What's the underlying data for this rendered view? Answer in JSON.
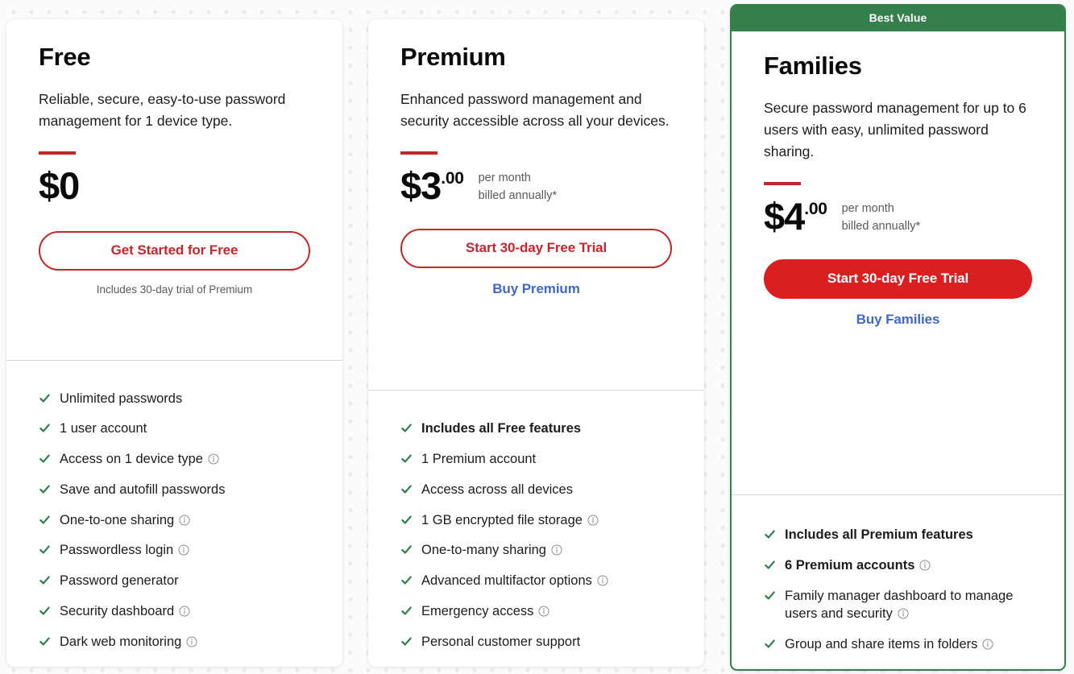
{
  "plans": [
    {
      "name": "Free",
      "description": "Reliable, secure, easy-to-use password management for 1 device type.",
      "price_main": "$0",
      "price_cents": "",
      "price_note_line1": "",
      "price_note_line2": "",
      "primary_cta": "Get Started for Free",
      "secondary_cta": "",
      "trial_note": "Includes 30-day trial of Premium",
      "badge": "",
      "features": [
        {
          "text": "Unlimited passwords",
          "bold": false,
          "info": false
        },
        {
          "text": "1 user account",
          "bold": false,
          "info": false
        },
        {
          "text": "Access on 1 device type",
          "bold": false,
          "info": true
        },
        {
          "text": "Save and autofill passwords",
          "bold": false,
          "info": false
        },
        {
          "text": "One-to-one sharing",
          "bold": false,
          "info": true
        },
        {
          "text": "Passwordless login",
          "bold": false,
          "info": true
        },
        {
          "text": "Password generator",
          "bold": false,
          "info": false
        },
        {
          "text": "Security dashboard",
          "bold": false,
          "info": true
        },
        {
          "text": "Dark web monitoring",
          "bold": false,
          "info": true
        }
      ]
    },
    {
      "name": "Premium",
      "description": "Enhanced password management and security accessible across all your devices.",
      "price_main": "$3",
      "price_cents": ".00",
      "price_note_line1": "per month",
      "price_note_line2": "billed annually*",
      "primary_cta": "Start 30-day Free Trial",
      "secondary_cta": "Buy Premium",
      "trial_note": "",
      "badge": "",
      "features": [
        {
          "text": "Includes all Free features",
          "bold": true,
          "info": false
        },
        {
          "text": "1 Premium account",
          "bold": false,
          "info": false
        },
        {
          "text": "Access across all devices",
          "bold": false,
          "info": false
        },
        {
          "text": "1 GB encrypted file storage",
          "bold": false,
          "info": true
        },
        {
          "text": "One-to-many sharing",
          "bold": false,
          "info": true
        },
        {
          "text": "Advanced multifactor options",
          "bold": false,
          "info": true
        },
        {
          "text": "Emergency access",
          "bold": false,
          "info": true
        },
        {
          "text": "Personal customer support",
          "bold": false,
          "info": false
        }
      ]
    },
    {
      "name": "Families",
      "description": "Secure password management for up to 6 users with easy, unlimited password sharing.",
      "price_main": "$4",
      "price_cents": ".00",
      "price_note_line1": "per month",
      "price_note_line2": "billed annually*",
      "primary_cta": "Start 30-day Free Trial",
      "secondary_cta": "Buy Families",
      "trial_note": "",
      "badge": "Best Value",
      "features": [
        {
          "text": "Includes all Premium features",
          "bold": true,
          "info": false
        },
        {
          "text": "6 Premium accounts",
          "bold": true,
          "info": true
        },
        {
          "text": "Family manager dashboard to manage users and security",
          "bold": false,
          "info": true
        },
        {
          "text": "Group and share items in folders",
          "bold": false,
          "info": true
        }
      ]
    }
  ],
  "icons": {
    "check": "check-icon",
    "info": "info-icon"
  },
  "colors": {
    "brand_red": "#c0282d",
    "filled_red": "#d91f1f",
    "best_value_green": "#347f4b",
    "link_blue": "#4169c4",
    "check_green": "#2f7a4b",
    "page_background": "#fbfbfb"
  }
}
